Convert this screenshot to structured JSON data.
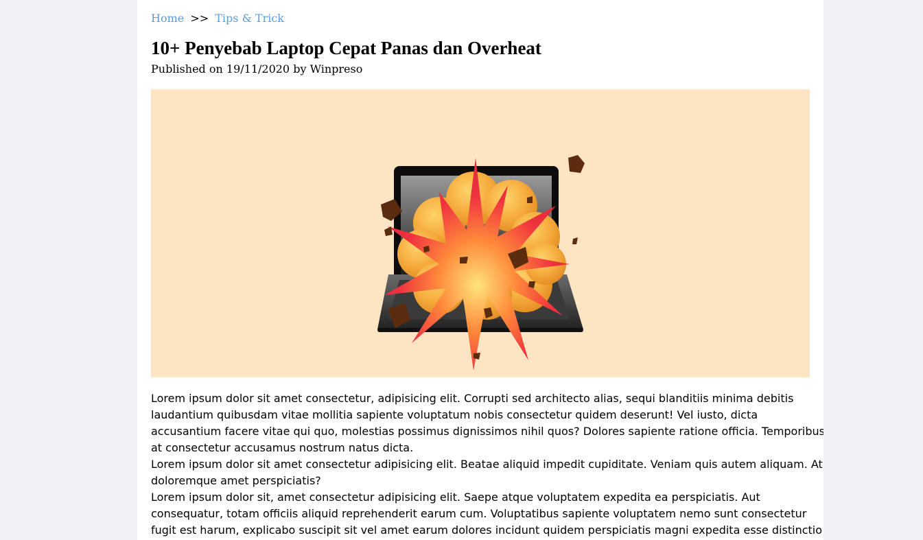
{
  "breadcrumb": {
    "home": "Home",
    "separator": ">>",
    "category": "Tips & Trick"
  },
  "article": {
    "title": "10+ Penyebab Laptop Cepat Panas dan Overheat",
    "meta": {
      "published_prefix": "Published on",
      "date": "19/11/2020",
      "by_prefix": "by",
      "author": "Winpreso"
    },
    "hero_image": {
      "subject": "exploding-laptop-illustration",
      "background_color": "#fde4c2"
    },
    "paragraphs": [
      "Lorem ipsum dolor sit amet consectetur, adipisicing elit. Corrupti sed architecto alias, sequi blanditiis minima debitis laudantium quibusdam vitae mollitia sapiente voluptatum nobis consectetur quidem deserunt! Vel iusto, dicta accusantium facere vitae qui quo, molestias possimus dignissimos nihil quos? Dolores sapiente ratione officia. Temporibus at consectetur accusamus nostrum natus dicta.",
      "Lorem ipsum dolor sit amet consectetur adipisicing elit. Beatae aliquid impedit cupiditate. Veniam quis autem aliquam. At doloremque amet perspiciatis?",
      "Lorem ipsum dolor sit, amet consectetur adipisicing elit. Saepe atque voluptatem expedita ea perspiciatis. Aut consequatur, totam officiis aliquid reprehenderit earum cum. Voluptatibus sapiente voluptatem nemo sunt consectetur fugit est harum, explicabo suscipit sit vel amet earum dolores incidunt quidem perspiciatis magni expedita esse distinctio"
    ]
  },
  "colors": {
    "page_background": "#eff1f5",
    "content_background": "#ffffff",
    "link": "#5b9be0"
  }
}
